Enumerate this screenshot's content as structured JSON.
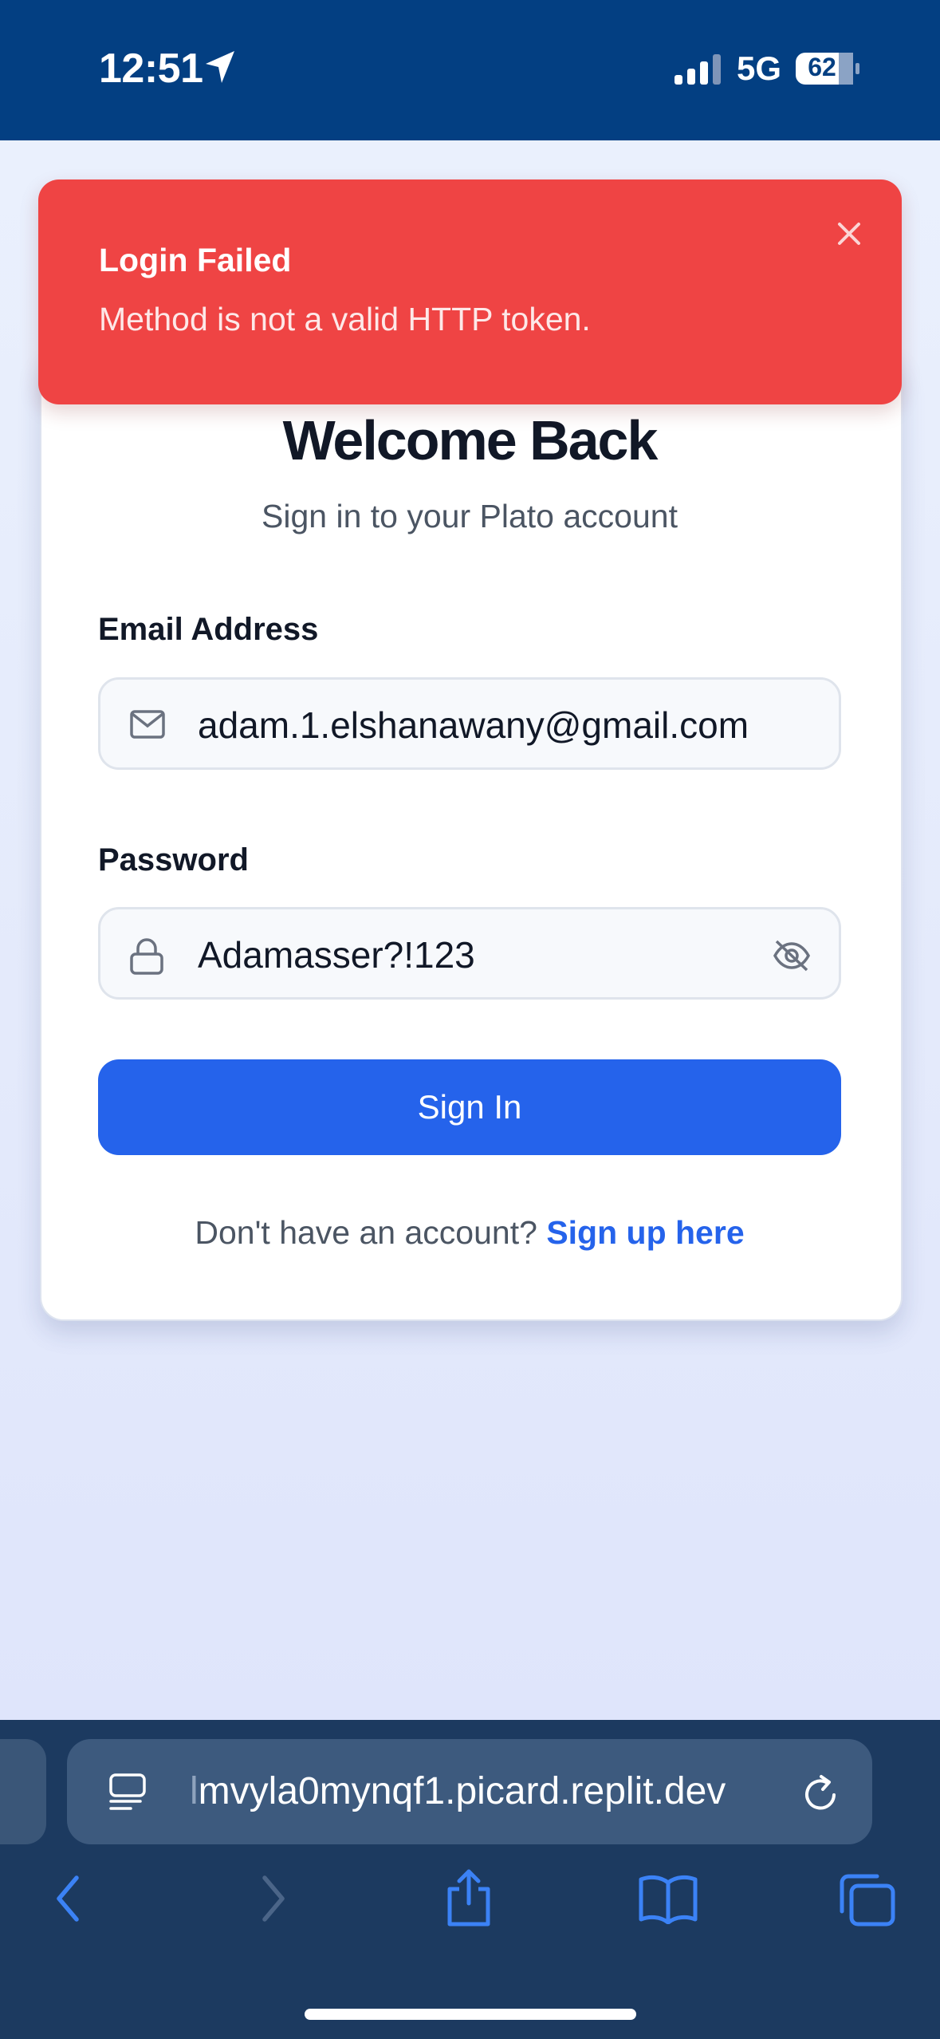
{
  "status_bar": {
    "time": "12:51",
    "network": "5G",
    "battery": "62"
  },
  "toast": {
    "title": "Login Failed",
    "message": "Method is not a valid HTTP token.",
    "close_icon": "close-icon"
  },
  "login": {
    "title": "Welcome Back",
    "subtitle": "Sign in to your Plato account",
    "email_label": "Email Address",
    "email_value": "adam.1.elshanawany@gmail.com",
    "password_label": "Password",
    "password_value": "Adamasser?!123",
    "sign_in_label": "Sign In",
    "no_account_text": "Don't have an account?",
    "signup_link": "Sign up here"
  },
  "browser": {
    "url": "lmvyla0mynqf1.picard.replit.dev",
    "toolbar_icons": [
      "back-icon",
      "forward-icon",
      "share-icon",
      "bookmarks-icon",
      "tabs-icon"
    ]
  },
  "colors": {
    "status_bar_bg": "#033f82",
    "toast_bg": "#ef4444",
    "primary": "#2563eb",
    "browser_bar_bg": "#1c3a60"
  }
}
